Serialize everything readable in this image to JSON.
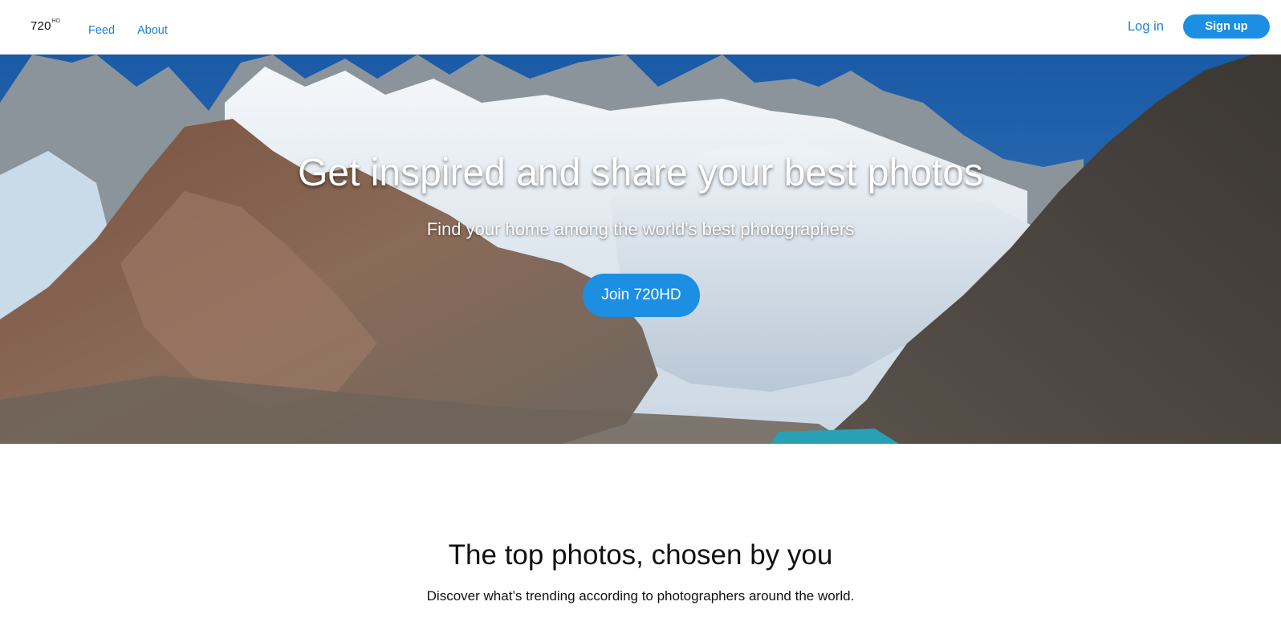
{
  "nav": {
    "logo_text": "720",
    "logo_sup": "HD",
    "links": [
      "Feed",
      "About"
    ],
    "login_label": "Log in",
    "signup_label": "Sign up"
  },
  "hero": {
    "title": "Get inspired and share your best photos",
    "subtitle": "Find your home among the world's best photographers",
    "cta_label": "Join 720HD",
    "image": "mountain-glacier-photo"
  },
  "section": {
    "title": "The top photos, chosen by you",
    "subtitle": "Discover what’s trending according to photographers around the world."
  },
  "colors": {
    "accent": "#1c8fe3",
    "link": "#1f7fd6",
    "text": "#111111",
    "background": "#ffffff"
  }
}
